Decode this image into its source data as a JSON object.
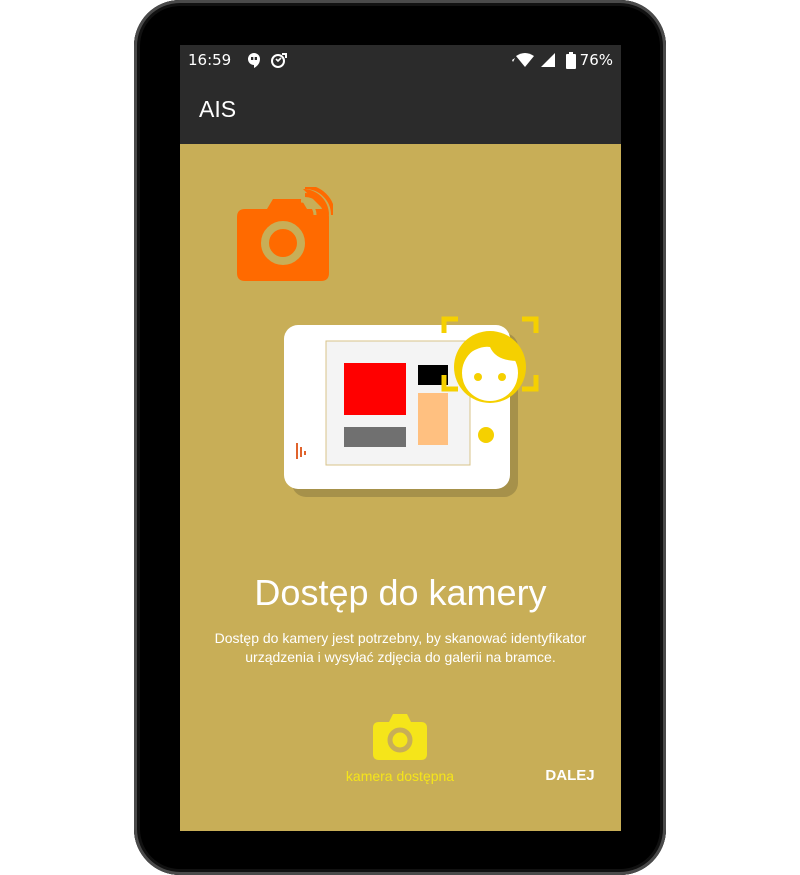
{
  "status_bar": {
    "time": "16:59",
    "battery_percent": "76%",
    "icons": [
      "hangouts-icon",
      "sync-icon",
      "wifi-icon",
      "signal-icon",
      "battery-icon"
    ]
  },
  "app_bar": {
    "title": "AIS"
  },
  "onboarding": {
    "headline": "Dostęp do kamery",
    "description": "Dostęp do kamery jest potrzebny, by skanować identyfikator urządzenia i wysyłać zdjęcia do galerii na bramce.",
    "camera_status_label": "kamera dostępna",
    "next_label": "DALEJ"
  },
  "colors": {
    "background": "#c8ae57",
    "app_bar": "#2b2b2b",
    "accent_orange": "#ff6a00",
    "accent_yellow": "#f5e51a"
  }
}
